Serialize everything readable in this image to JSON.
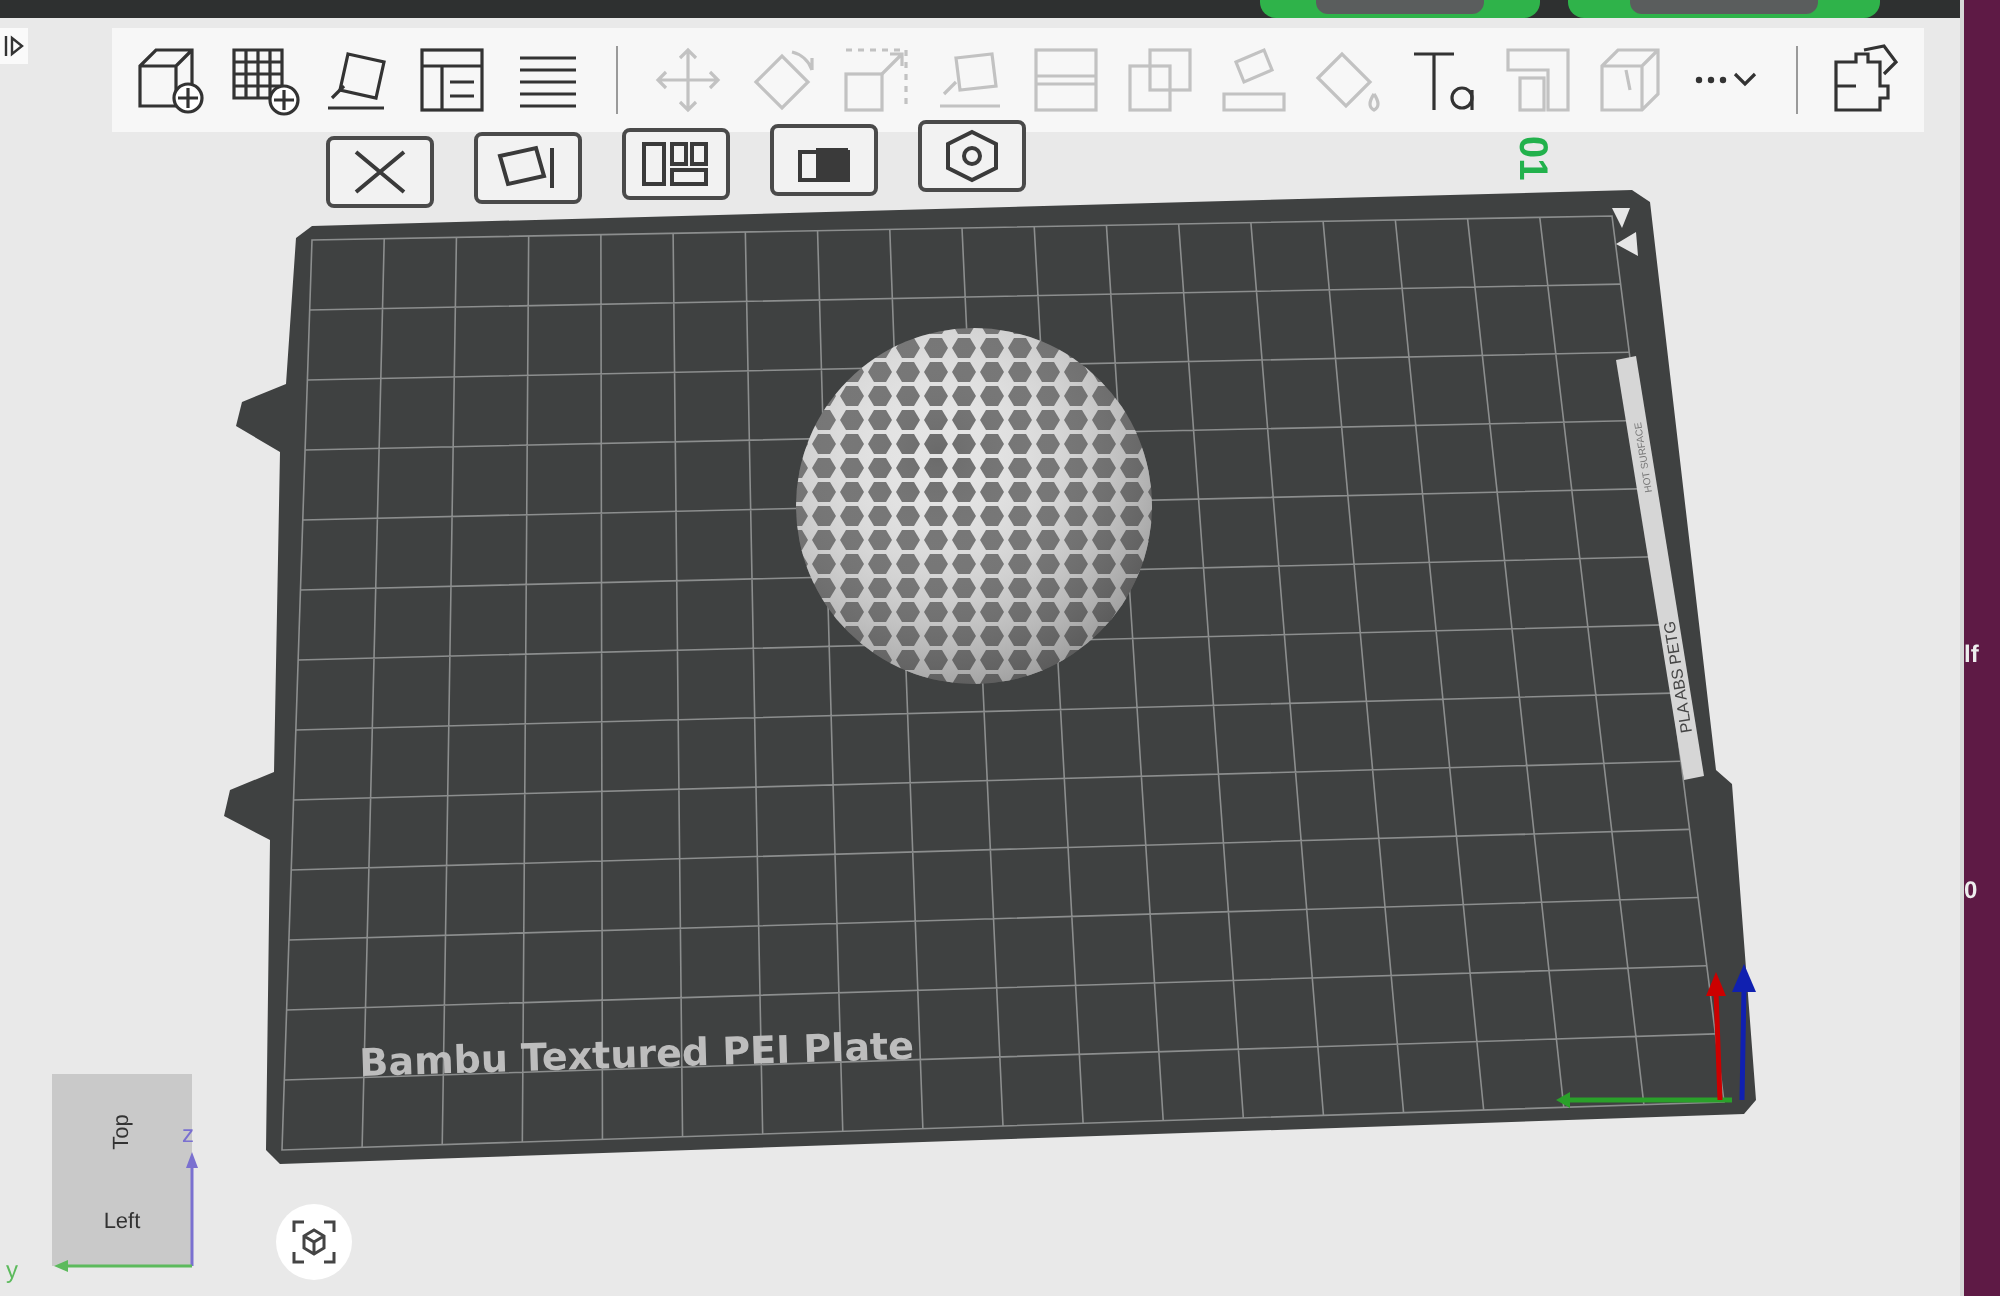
{
  "toolbar": {
    "tools": [
      {
        "kind": "add-cube",
        "disabled": false
      },
      {
        "kind": "add-plate",
        "disabled": false
      },
      {
        "kind": "auto-orient",
        "disabled": false
      },
      {
        "kind": "arrange",
        "disabled": false
      },
      {
        "kind": "list",
        "disabled": false
      },
      {
        "kind": "divider"
      },
      {
        "kind": "move",
        "disabled": true
      },
      {
        "kind": "rotate",
        "disabled": true
      },
      {
        "kind": "scale",
        "disabled": true
      },
      {
        "kind": "lay-flat",
        "disabled": true
      },
      {
        "kind": "cut",
        "disabled": true
      },
      {
        "kind": "boolean",
        "disabled": true
      },
      {
        "kind": "support-paint",
        "disabled": true
      },
      {
        "kind": "color-paint",
        "disabled": true
      },
      {
        "kind": "text",
        "disabled": false
      },
      {
        "kind": "emboss",
        "disabled": true
      },
      {
        "kind": "measure",
        "disabled": true
      },
      {
        "kind": "more",
        "disabled": false
      },
      {
        "kind": "divider"
      },
      {
        "kind": "assembly",
        "disabled": false
      }
    ]
  },
  "plate_tools": [
    {
      "kind": "delete"
    },
    {
      "kind": "auto-orient"
    },
    {
      "kind": "arrange"
    },
    {
      "kind": "lock"
    },
    {
      "kind": "settings"
    }
  ],
  "plate": {
    "number": "01",
    "name": "Bambu Textured PEI Plate",
    "warning": "HOT SURFACE",
    "materials": "PLA ABS PETG"
  },
  "view_cube": {
    "top": "Top",
    "left": "Left",
    "axes": [
      "z",
      "y"
    ]
  },
  "side_window": {
    "texts": [
      "lf",
      "0"
    ]
  }
}
